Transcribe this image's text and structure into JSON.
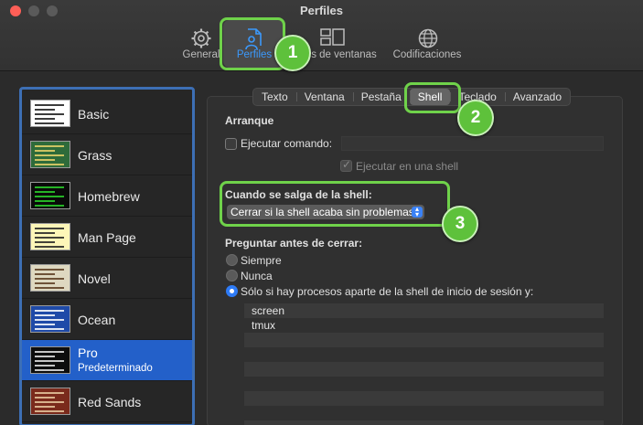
{
  "window": {
    "title": "Perfiles"
  },
  "toolbar": {
    "items": [
      {
        "label": "General",
        "icon": "gear-icon"
      },
      {
        "label": "Perfiles",
        "icon": "profile-document-icon"
      },
      {
        "label": "Grupos de ventanas",
        "visible_label": "s de ventanas",
        "icon": "window-groups-icon"
      },
      {
        "label": "Codificaciones",
        "icon": "globe-icon"
      }
    ]
  },
  "callouts": [
    "1",
    "2",
    "3"
  ],
  "profiles": [
    {
      "name": "Basic",
      "bg": "#ffffff",
      "fg": "#1a1a1a",
      "sub": ""
    },
    {
      "name": "Grass",
      "bg": "#2e6b3a",
      "fg": "#e8d26a",
      "sub": ""
    },
    {
      "name": "Homebrew",
      "bg": "#0a0a0a",
      "fg": "#2bd12b",
      "sub": ""
    },
    {
      "name": "Man Page",
      "bg": "#fdf6b8",
      "fg": "#222222",
      "sub": ""
    },
    {
      "name": "Novel",
      "bg": "#ded8c0",
      "fg": "#5a3b1f",
      "sub": ""
    },
    {
      "name": "Ocean",
      "bg": "#1f4aa8",
      "fg": "#ffffff",
      "sub": ""
    },
    {
      "name": "Pro",
      "bg": "#0d0d0d",
      "fg": "#e6e6e6",
      "sub": "Predeterminado"
    },
    {
      "name": "Red Sands",
      "bg": "#7a2a1c",
      "fg": "#e8c9a0",
      "sub": ""
    }
  ],
  "tabs": [
    {
      "label": "Texto"
    },
    {
      "label": "Ventana"
    },
    {
      "label": "Pestaña"
    },
    {
      "label": "Shell"
    },
    {
      "label": "Teclado"
    },
    {
      "label": "Avanzado"
    }
  ],
  "shell": {
    "arranque_heading": "Arranque",
    "ejecutar_comando": "Ejecutar comando:",
    "ejecutar_en_shell": "Ejecutar en una shell",
    "cuando_salga_heading": "Cuando se salga de la shell:",
    "exit_action": "Cerrar si la shell acaba sin problemas",
    "preguntar_heading": "Preguntar antes de cerrar:",
    "options": [
      {
        "label": "Siempre"
      },
      {
        "label": "Nunca"
      },
      {
        "label": "Sólo si hay procesos aparte de la shell de inicio de sesión y:"
      }
    ],
    "process_list": [
      "screen",
      "tmux"
    ]
  }
}
